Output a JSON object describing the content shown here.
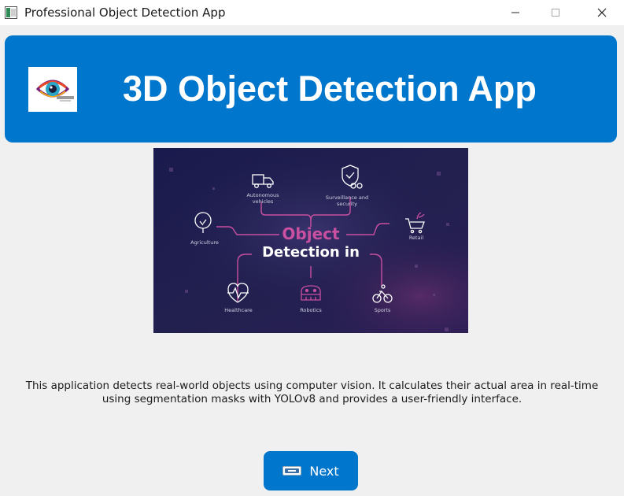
{
  "window": {
    "title": "Professional Object Detection App",
    "icons": {
      "app": "app-window-icon",
      "minimize": "minimize-icon",
      "maximize": "maximize-icon",
      "close": "close-icon"
    }
  },
  "header": {
    "title": "3D Object Detection App",
    "logo_icon": "eye-logo-icon",
    "background": "#0077cc"
  },
  "hero": {
    "headline_top": "Object",
    "headline_bottom": "Detection in",
    "nodes": [
      {
        "key": "autonomous",
        "label_line1": "Autonomous",
        "label_line2": "vehicles",
        "icon": "truck-icon"
      },
      {
        "key": "surveillance",
        "label_line1": "Surveillance and",
        "label_line2": "security",
        "icon": "shield-binoculars-icon"
      },
      {
        "key": "agriculture",
        "label_line1": "Agriculture",
        "label_line2": "",
        "icon": "tree-icon"
      },
      {
        "key": "retail",
        "label_line1": "Retail",
        "label_line2": "",
        "icon": "shopping-cart-icon"
      },
      {
        "key": "healthcare",
        "label_line1": "Healthcare",
        "label_line2": "",
        "icon": "heart-pulse-icon"
      },
      {
        "key": "robotics",
        "label_line1": "Robotics",
        "label_line2": "",
        "icon": "robot-icon"
      },
      {
        "key": "sports",
        "label_line1": "Sports",
        "label_line2": "",
        "icon": "bicycle-icon"
      }
    ],
    "colors": {
      "bg_dark": "#1c1a4a",
      "accent_pink": "#c94fa0",
      "text_light": "#ffffff"
    }
  },
  "description": "This application detects real-world objects using computer vision. It calculates their actual area in real-time using segmentation masks with YOLOv8 and provides a user-friendly interface.",
  "next_button": {
    "label": "Next",
    "icon": "next-badge-icon",
    "color": "#0077cc"
  }
}
